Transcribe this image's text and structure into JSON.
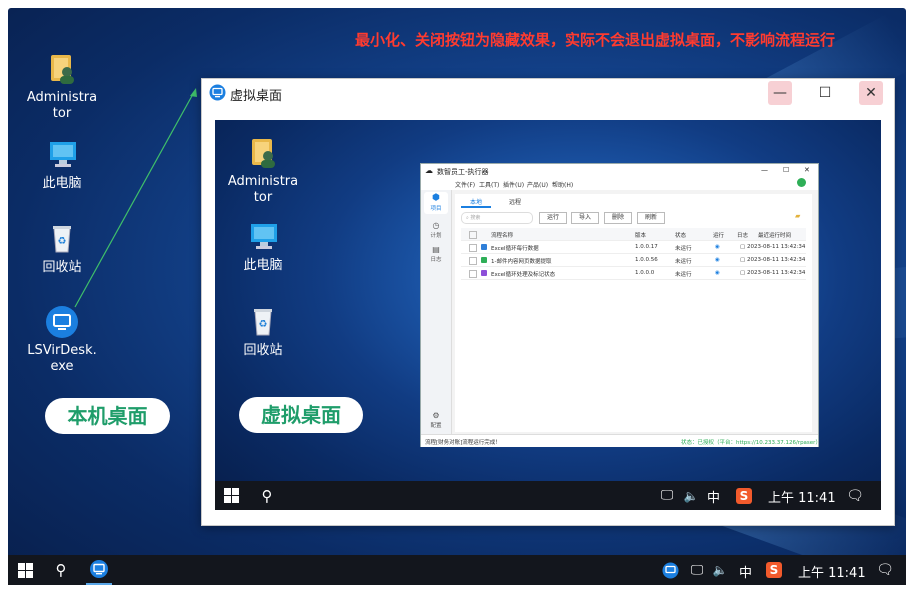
{
  "notice": "最小化、关闭按钮为隐藏效果，实际不会退出虚拟桌面，不影响流程运行",
  "desktop_icons": [
    {
      "label": "Administrator",
      "icon": "admin-folder-icon"
    },
    {
      "label": "此电脑",
      "icon": "computer-icon"
    },
    {
      "label": "回收站",
      "icon": "recycle-bin-icon"
    },
    {
      "label": "LSVirDesk.exe",
      "icon": "lsvirdesk-icon"
    }
  ],
  "labels": {
    "local": "本机桌面",
    "virtual": "虚拟桌面"
  },
  "vwindow": {
    "title": "虚拟桌面",
    "minimize": "—",
    "maximize": "☐",
    "close": "✕"
  },
  "vdesktop_icons": [
    {
      "label": "Administrator"
    },
    {
      "label": "此电脑"
    },
    {
      "label": "回收站"
    }
  ],
  "taskbar": {
    "ime": "中",
    "time": "上午 11:41"
  },
  "app": {
    "title": "数智员工-执行器",
    "menu": [
      "文件(F)",
      "工具(T)",
      "插件(U)",
      "产品(U)",
      "帮助(H)"
    ],
    "side": [
      "项目",
      "计划",
      "日志",
      "配置"
    ],
    "tabs": [
      "本地",
      "远程"
    ],
    "search_placeholder": "搜索",
    "buttons": [
      "运行",
      "导入",
      "删除",
      "刷新"
    ],
    "columns": [
      "流程名称",
      "版本",
      "状态",
      "运行",
      "日志",
      "最近运行时间"
    ],
    "rows": [
      {
        "name": "Excel循环每行数据",
        "version": "1.0.0.17",
        "status": "未运行",
        "time": "2023-08-11 13:42:34",
        "color": "#2f7fd8"
      },
      {
        "name": "1-邮件内容网页数据提取",
        "version": "1.0.0.56",
        "status": "未运行",
        "time": "2023-08-11 13:42:34",
        "color": "#2eae57"
      },
      {
        "name": "Excel循环处理及标记状态",
        "version": "1.0.0.0",
        "status": "未运行",
        "time": "2023-08-11 13:42:34",
        "color": "#8d4fd8"
      }
    ],
    "status_left": "流程[财务对账]流程运行完成！",
    "status_right": "状态：已授权（平台：https://10.233.37.126/rpaser）"
  },
  "colors": {
    "notice": "#ff3b2f",
    "pill_text": "#1f9d6a",
    "arrow": "#3fbf6a"
  }
}
